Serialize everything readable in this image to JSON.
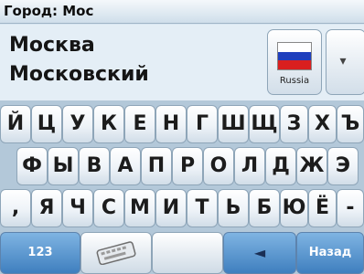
{
  "header": {
    "city_label": "Город: Мос"
  },
  "suggestions": [
    "Москва",
    "Московский"
  ],
  "country": {
    "name": "Russia",
    "flag_colors": [
      "#ffffff",
      "#1f3fbd",
      "#d91f1f"
    ]
  },
  "dropdown": {
    "icon": "chevron-down-icon",
    "glyph": "▾"
  },
  "keyboard": {
    "row1": [
      "Й",
      "Ц",
      "У",
      "К",
      "Е",
      "Н",
      "Г",
      "Ш",
      "Щ",
      "З",
      "Х",
      "Ъ"
    ],
    "row2": [
      "Ф",
      "Ы",
      "В",
      "А",
      "П",
      "Р",
      "О",
      "Л",
      "Д",
      "Ж",
      "Э"
    ],
    "row3": [
      ",",
      "Я",
      "Ч",
      "С",
      "М",
      "И",
      "Т",
      "Ь",
      "Б",
      "Ю",
      "Ё",
      "-"
    ]
  },
  "bottom_bar": {
    "numbers_label": "123",
    "keyboard_icon": "keyboard-icon",
    "back_arrow_glyph": "◄",
    "back_label": "Назад"
  },
  "colors": {
    "accent_blue": "#4a8ac9",
    "key_text": "#1c1c1c"
  }
}
